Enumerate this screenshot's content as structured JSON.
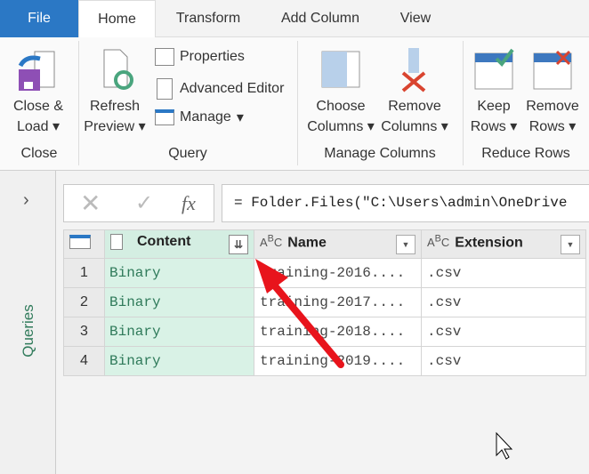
{
  "tabs": [
    {
      "label": "File"
    },
    {
      "label": "Home"
    },
    {
      "label": "Transform"
    },
    {
      "label": "Add Column"
    },
    {
      "label": "View"
    }
  ],
  "ribbon": {
    "close_load": {
      "line1": "Close &",
      "line2": "Load"
    },
    "refresh": {
      "line1": "Refresh",
      "line2": "Preview"
    },
    "properties": "Properties",
    "advanced_editor": "Advanced Editor",
    "manage": "Manage",
    "choose_columns": {
      "line1": "Choose",
      "line2": "Columns"
    },
    "remove_columns": {
      "line1": "Remove",
      "line2": "Columns"
    },
    "keep_rows": {
      "line1": "Keep",
      "line2": "Rows"
    },
    "remove_rows": {
      "line1": "Remove",
      "line2": "Rows"
    },
    "groups": {
      "close": "Close",
      "query": "Query",
      "manage_columns": "Manage Columns",
      "reduce_rows": "Reduce Rows"
    }
  },
  "queries_pane": {
    "label": "Queries"
  },
  "formula": {
    "fx": "fx",
    "text": "= Folder.Files(\"C:\\Users\\admin\\OneDrive"
  },
  "table": {
    "columns": [
      "Content",
      "Name",
      "Extension"
    ],
    "rows": [
      {
        "n": "1",
        "content": "Binary",
        "name": "training-2016....",
        "ext": ".csv"
      },
      {
        "n": "2",
        "content": "Binary",
        "name": "training-2017....",
        "ext": ".csv"
      },
      {
        "n": "3",
        "content": "Binary",
        "name": "training-2018....",
        "ext": ".csv"
      },
      {
        "n": "4",
        "content": "Binary",
        "name": "training-2019....",
        "ext": ".csv"
      }
    ]
  },
  "colors": {
    "file_tab": "#2b78c5",
    "binary_bg": "#d9f2e6",
    "binary_text": "#2f7a5a",
    "arrow": "#e8141c",
    "queries_text": "#2f7a5a"
  }
}
